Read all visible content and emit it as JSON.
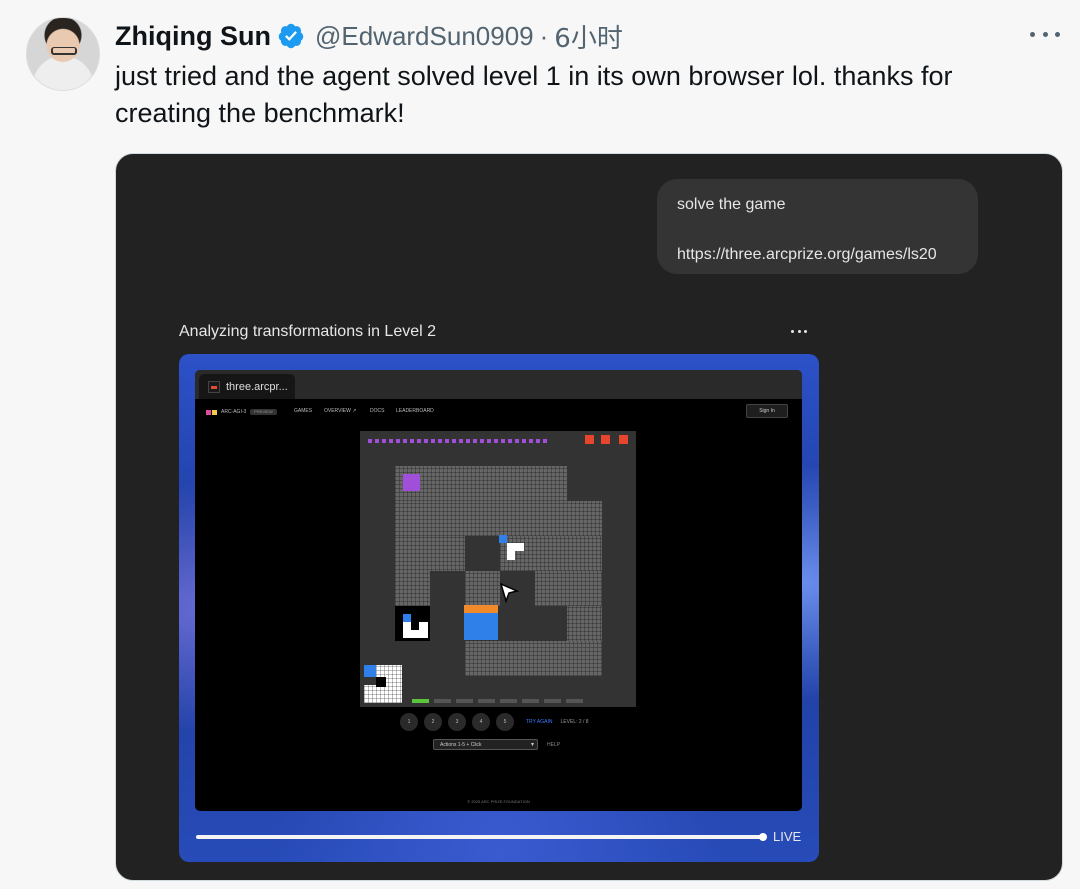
{
  "author": {
    "display_name": "Zhiqing Sun",
    "handle": "@EdwardSun0909",
    "separator": "·",
    "time": "6小时"
  },
  "tweet": {
    "text": "just tried and the agent solved level 1 in its own browser lol. thanks for creating the benchmark!"
  },
  "media": {
    "chat": {
      "line1": "solve the game",
      "line2": "https://three.arcprize.org/games/ls20"
    },
    "status_title": "Analyzing transformations in Level 2",
    "live_label": "LIVE",
    "progress": 0.99,
    "browser": {
      "tab_title": "three.arcpr...",
      "nav": {
        "brand": "ARC-AGI-3",
        "preview": "PREVIEW",
        "links": [
          "GAMES",
          "OVERVIEW ↗",
          "DOCS",
          "LEADERBOARD"
        ],
        "signin": "Sign In"
      },
      "controls": {
        "buttons": [
          "1",
          "2",
          "3",
          "4",
          "5"
        ],
        "try_again": "TRY AGAIN",
        "level": "LEVEL: 2 / 8",
        "action_select": "Actions 1-5 + Click",
        "help": "HELP"
      },
      "copyright": "© 2025 ARC PRIZE FOUNDATION"
    }
  },
  "colors": {
    "verified": "#1d9bf0",
    "grid_light": "#666666",
    "grid_dark": "#333333",
    "purple": "#a04fd8",
    "red": "#e8452e",
    "orange": "#f08a2a",
    "blue": "#2f80e8",
    "green": "#5ac43a"
  },
  "icons": [
    "verified-icon",
    "more-icon",
    "cursor-icon",
    "favicon-icon"
  ]
}
